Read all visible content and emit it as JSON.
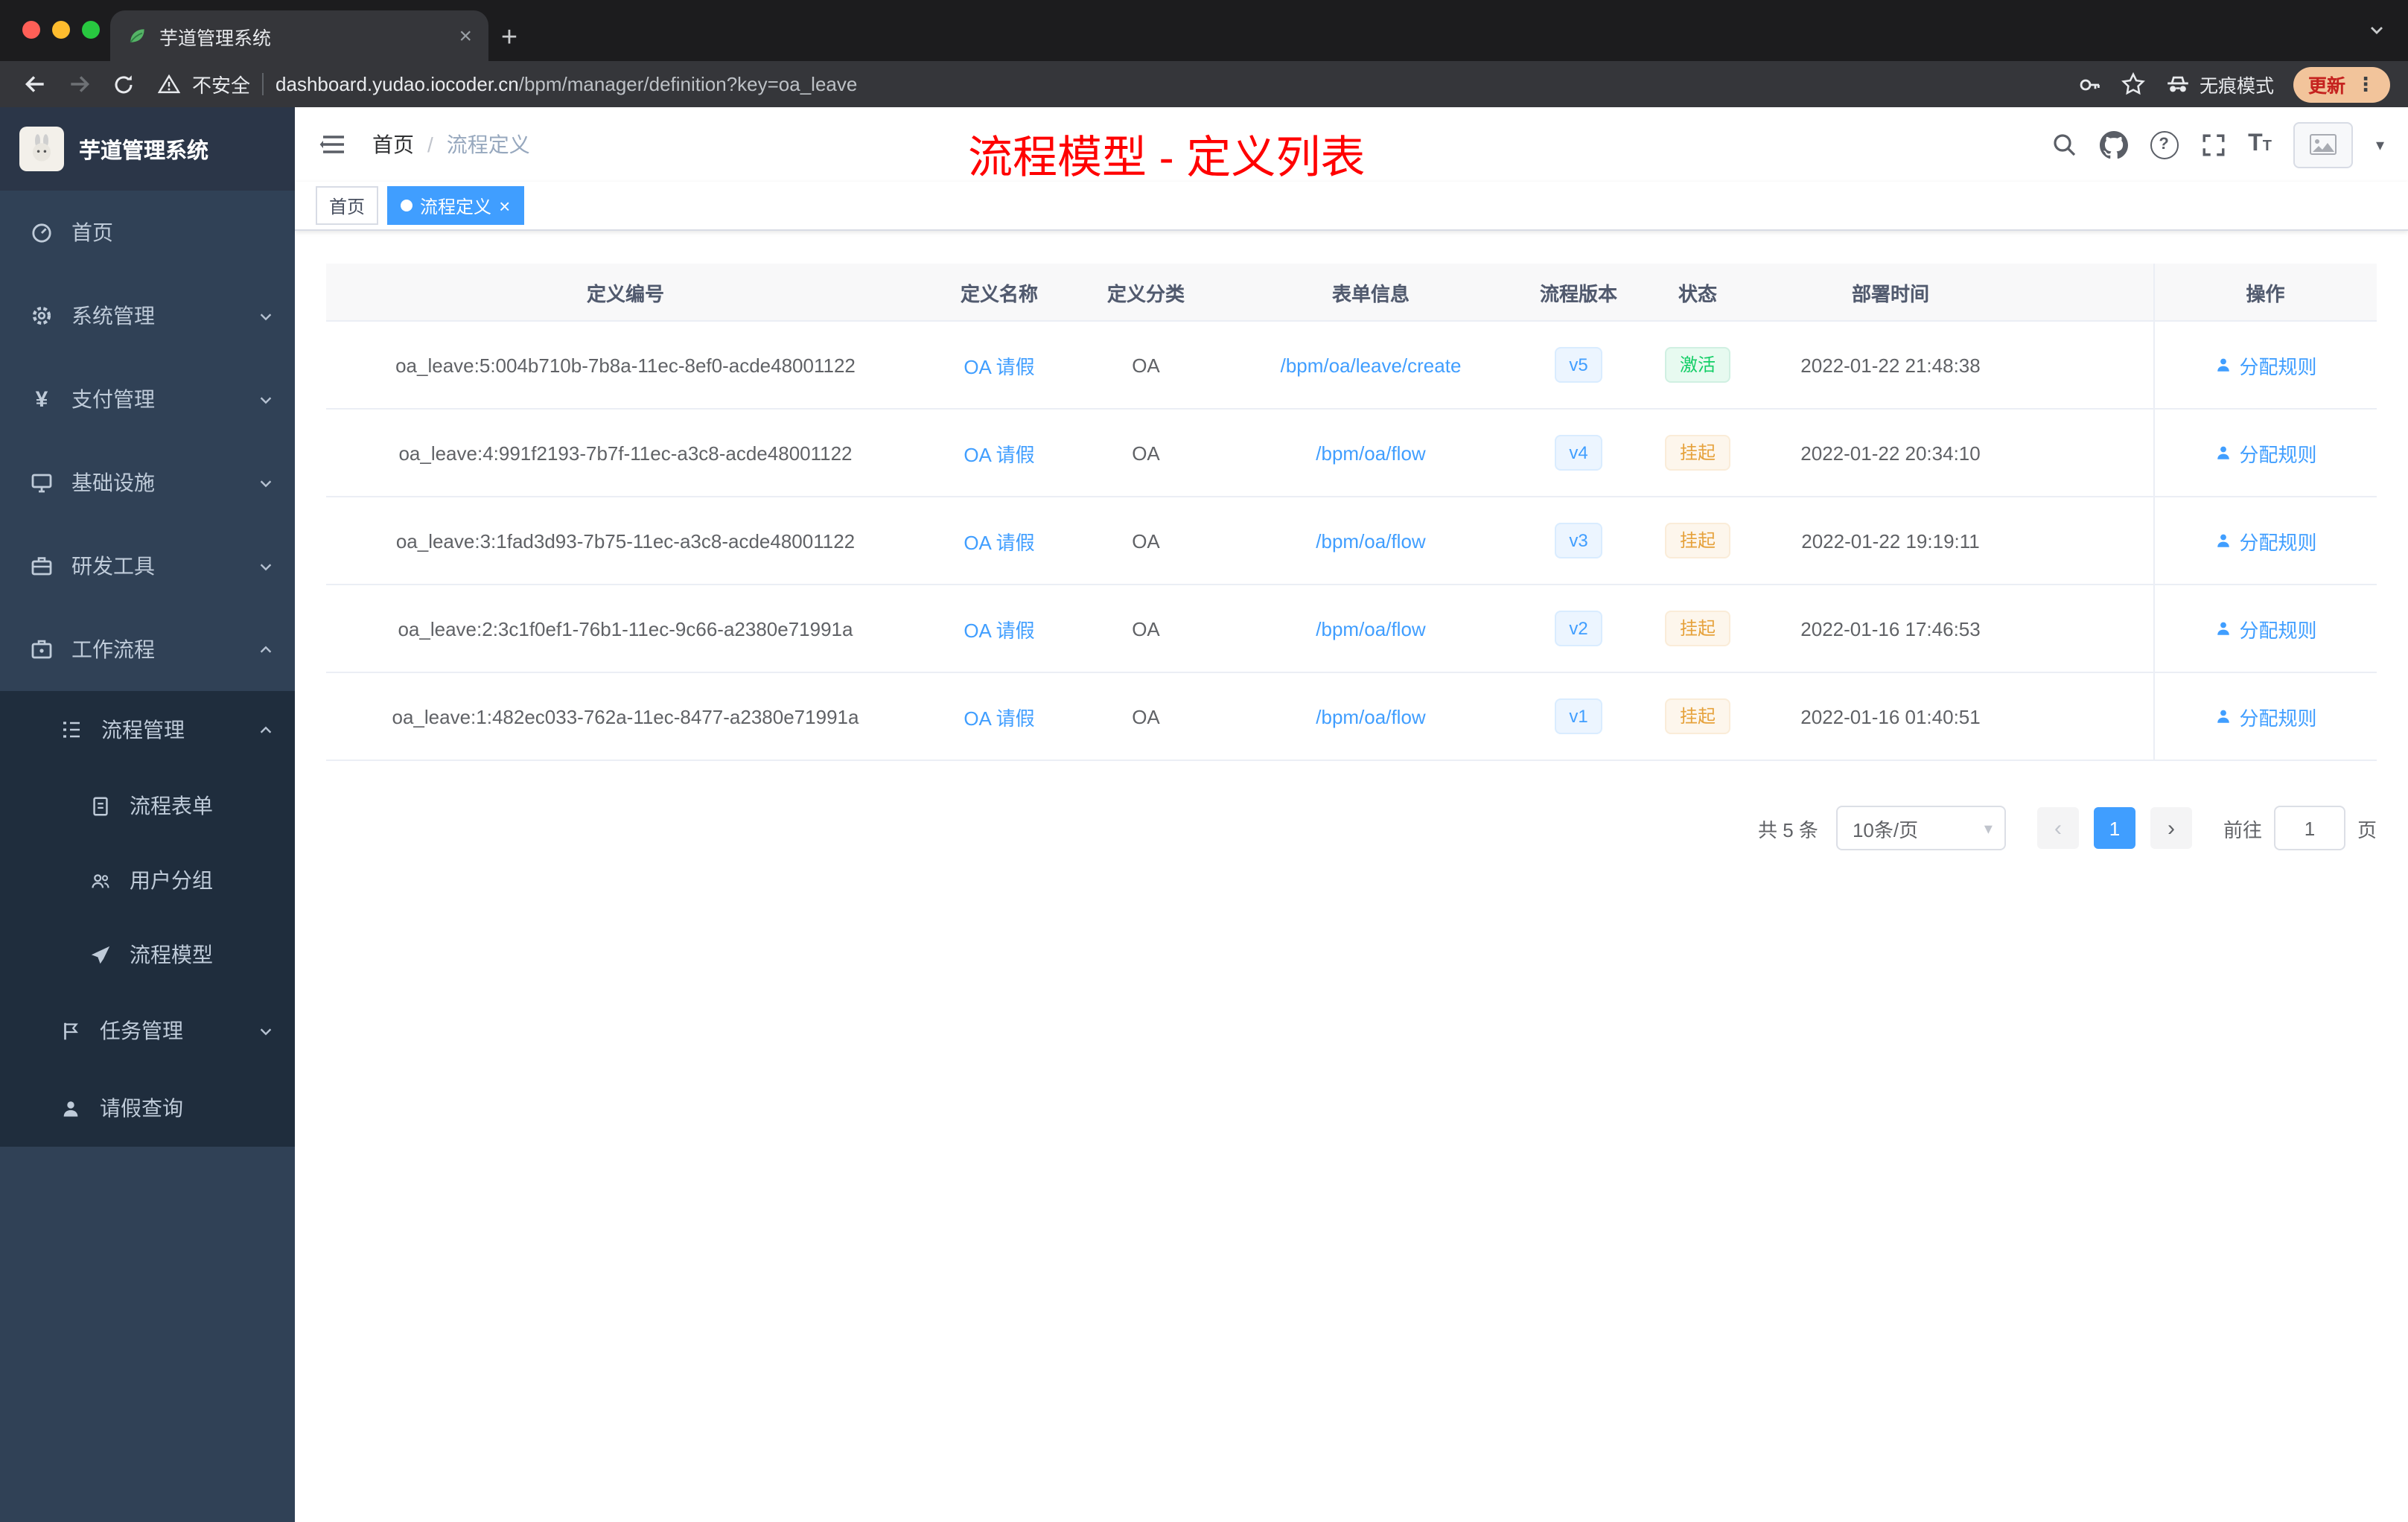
{
  "colors": {
    "accent": "#409eff",
    "success": "#13ce66",
    "warning": "#e6a23c",
    "annotation_red": "#ff0000",
    "sidebar_bg": "#304156",
    "submenu_bg": "#1f2d3d"
  },
  "browser": {
    "tab_title": "芋道管理系统",
    "security_label": "不安全",
    "url_host": "dashboard.yudao.iocoder.cn",
    "url_path": "/bpm/manager/definition?key=oa_leave",
    "incognito_label": "无痕模式",
    "update_label": "更新"
  },
  "sidebar": {
    "logo_title": "芋道管理系统",
    "items": [
      {
        "label": "首页",
        "icon": "dashboard-icon"
      },
      {
        "label": "系统管理",
        "icon": "gear-icon",
        "chevron": "down"
      },
      {
        "label": "支付管理",
        "icon": "yen-icon",
        "chevron": "down"
      },
      {
        "label": "基础设施",
        "icon": "infrastructure-icon",
        "chevron": "down"
      },
      {
        "label": "研发工具",
        "icon": "tools-icon",
        "chevron": "down"
      },
      {
        "label": "工作流程",
        "icon": "workflow-icon",
        "chevron": "up"
      },
      {
        "label": "流程管理",
        "icon": "process-list-icon",
        "chevron": "up"
      },
      {
        "label": "流程表单",
        "icon": "form-icon"
      },
      {
        "label": "用户分组",
        "icon": "user-group-icon"
      },
      {
        "label": "流程模型",
        "icon": "paper-plane-icon"
      },
      {
        "label": "任务管理",
        "icon": "task-flag-icon",
        "chevron": "down"
      },
      {
        "label": "请假查询",
        "icon": "person-icon"
      }
    ]
  },
  "header": {
    "breadcrumb": [
      "首页",
      "流程定义"
    ],
    "annotation": "流程模型 - 定义列表"
  },
  "tags": [
    {
      "label": "首页",
      "active": false
    },
    {
      "label": "流程定义",
      "active": true
    }
  ],
  "table": {
    "columns": [
      "定义编号",
      "定义名称",
      "定义分类",
      "表单信息",
      "流程版本",
      "状态",
      "部署时间",
      "操作"
    ],
    "rows": [
      {
        "id": "oa_leave:5:004b710b-7b8a-11ec-8ef0-acde48001122",
        "name": "OA 请假",
        "category": "OA",
        "form": "/bpm/oa/leave/create",
        "version": "v5",
        "status": "激活",
        "status_type": "success",
        "deploy_time": "2022-01-22 21:48:38",
        "action": "分配规则"
      },
      {
        "id": "oa_leave:4:991f2193-7b7f-11ec-a3c8-acde48001122",
        "name": "OA 请假",
        "category": "OA",
        "form": "/bpm/oa/flow",
        "version": "v4",
        "status": "挂起",
        "status_type": "warning",
        "deploy_time": "2022-01-22 20:34:10",
        "action": "分配规则"
      },
      {
        "id": "oa_leave:3:1fad3d93-7b75-11ec-a3c8-acde48001122",
        "name": "OA 请假",
        "category": "OA",
        "form": "/bpm/oa/flow",
        "version": "v3",
        "status": "挂起",
        "status_type": "warning",
        "deploy_time": "2022-01-22 19:19:11",
        "action": "分配规则"
      },
      {
        "id": "oa_leave:2:3c1f0ef1-76b1-11ec-9c66-a2380e71991a",
        "name": "OA 请假",
        "category": "OA",
        "form": "/bpm/oa/flow",
        "version": "v2",
        "status": "挂起",
        "status_type": "warning",
        "deploy_time": "2022-01-16 17:46:53",
        "action": "分配规则"
      },
      {
        "id": "oa_leave:1:482ec033-762a-11ec-8477-a2380e71991a",
        "name": "OA 请假",
        "category": "OA",
        "form": "/bpm/oa/flow",
        "version": "v1",
        "status": "挂起",
        "status_type": "warning",
        "deploy_time": "2022-01-16 01:40:51",
        "action": "分配规则"
      }
    ]
  },
  "pagination": {
    "total": "共 5 条",
    "page_size": "10条/页",
    "current_page": "1",
    "goto_label": "前往",
    "goto_value": "1",
    "page_unit": "页"
  }
}
